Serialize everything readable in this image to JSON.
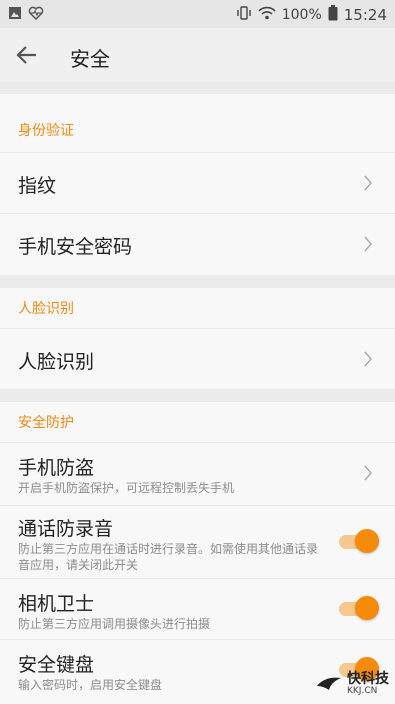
{
  "status": {
    "battery": "100%",
    "time": "15:24",
    "icons": [
      "image-icon",
      "heart-monitor-icon",
      "vibrate-icon",
      "wifi-icon",
      "battery-icon"
    ]
  },
  "header": {
    "title": "安全",
    "back_icon": "back-arrow-icon"
  },
  "sections": {
    "identity": {
      "title": "身份验证",
      "items": [
        {
          "label": "指纹"
        },
        {
          "label": "手机安全密码"
        }
      ]
    },
    "face": {
      "title": "人脸识别",
      "items": [
        {
          "label": "人脸识别"
        }
      ]
    },
    "protection": {
      "title": "安全防护",
      "items": [
        {
          "label": "手机防盗",
          "sub": "开启手机防盗保护，可远程控制丢失手机"
        },
        {
          "label": "通话防录音",
          "sub": "防止第三方应用在通话时进行录音。如需使用其他通话录音应用，请关闭此开关",
          "on": true
        },
        {
          "label": "相机卫士",
          "sub": "防止第三方应用调用摄像头进行拍摄",
          "on": true
        },
        {
          "label": "安全键盘",
          "sub": "输入密码时，启用安全键盘",
          "on": true
        }
      ]
    }
  },
  "watermark": {
    "text": "快科技",
    "sub": "KKJ.CN"
  },
  "colors": {
    "accent": "#ee8a15",
    "toggle_on": "#f68a0a",
    "toggle_track": "#f4c88f"
  }
}
